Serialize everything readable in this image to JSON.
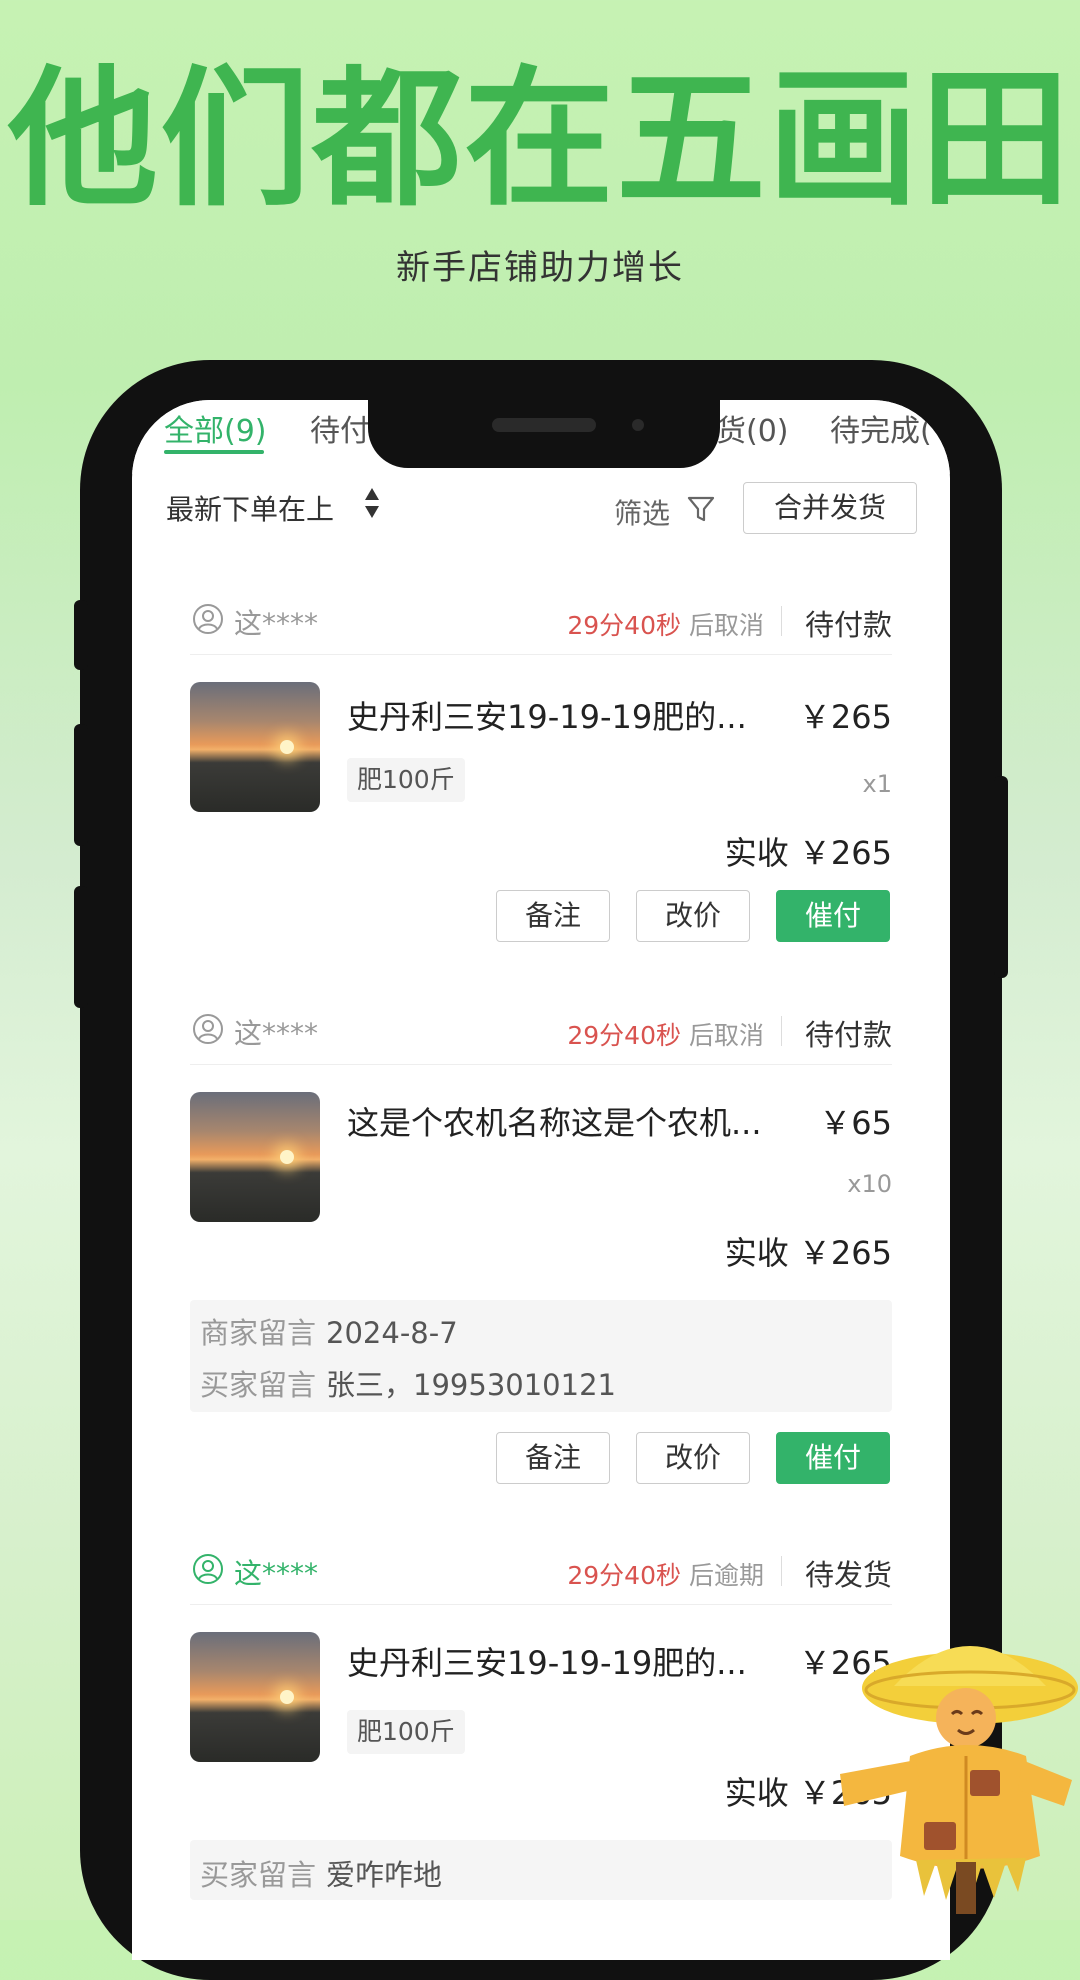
{
  "hero": {
    "title": "他们都在五画田",
    "subtitle": "新手店铺助力增长"
  },
  "tabs": [
    {
      "label": "全部(9)",
      "active": true
    },
    {
      "label": "待付"
    },
    {
      "label": "货(0)"
    },
    {
      "label": "待完成("
    }
  ],
  "toolbar": {
    "sort_label": "最新下单在上",
    "filter_label": "筛选",
    "merge_label": "合并发货"
  },
  "orders": [
    {
      "user": "这****",
      "countdown": "29分40秒",
      "countdown_suffix": "后取消",
      "status": "待付款",
      "product_name": "史丹利三安19-19-19肥的...",
      "price": "￥265",
      "spec": "肥100斤",
      "qty": "x1",
      "received": "实收 ￥265",
      "buttons": [
        "备注",
        "改价",
        "催付"
      ]
    },
    {
      "user": "这****",
      "countdown": "29分40秒",
      "countdown_suffix": "后取消",
      "status": "待付款",
      "product_name": "这是个农机名称这是个农机...",
      "price": "￥65",
      "qty": "x10",
      "received": "实收 ￥265",
      "notes": [
        {
          "label": "商家留言",
          "value": "2024-8-7"
        },
        {
          "label": "买家留言",
          "value": "张三，19953010121"
        }
      ],
      "buttons": [
        "备注",
        "改价",
        "催付"
      ]
    },
    {
      "user": "这****",
      "countdown": "29分40秒",
      "countdown_suffix": "后逾期",
      "status": "待发货",
      "product_name": "史丹利三安19-19-19肥的...",
      "price": "￥265",
      "spec": "肥100斤",
      "received": "实收 ￥265",
      "notes": [
        {
          "label": "买家留言",
          "value": "爱咋咋地"
        }
      ]
    }
  ],
  "colors": {
    "brand_green": "#3fb550",
    "accent_green": "#33b36a",
    "countdown_red": "#d9534f"
  }
}
